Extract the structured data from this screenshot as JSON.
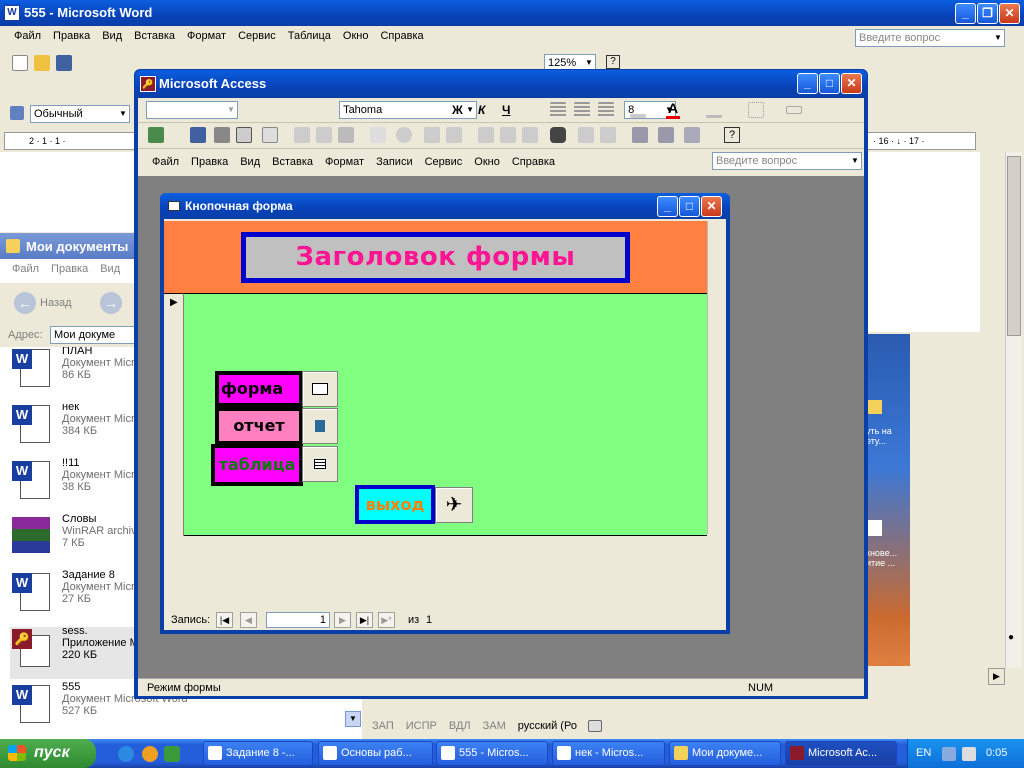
{
  "word": {
    "title": "555 - Microsoft Word",
    "menu": [
      "Файл",
      "Правка",
      "Вид",
      "Вставка",
      "Формат",
      "Сервис",
      "Таблица",
      "Окно",
      "Справка"
    ],
    "ask_placeholder": "Введите вопрос",
    "zoom": "125%",
    "style": "Обычный",
    "ruler_left": "2 · 1 · 1 ·",
    "ruler_right": "· 16 · ↓ · 17 ·",
    "status": [
      "ЗАП",
      "ИСПР",
      "ВДЛ",
      "ЗАМ",
      "русский (Ро"
    ]
  },
  "explorer": {
    "title": "Мои документы",
    "menu": [
      "Файл",
      "Правка",
      "Вид"
    ],
    "back": "Назад",
    "address_label": "Адрес:",
    "address_value": "Мои докуме",
    "files": [
      {
        "name": "ПЛАН",
        "type": "Документ Micr",
        "size": "86 КБ",
        "icon": "word-doc-icon"
      },
      {
        "name": "нек",
        "type": "Документ Micr",
        "size": "384 КБ",
        "icon": "word-doc-icon"
      },
      {
        "name": "!!11",
        "type": "Документ Micr",
        "size": "38 КБ",
        "icon": "word-doc-icon"
      },
      {
        "name": "Словы",
        "type": "WinRAR archiv",
        "size": "7 КБ",
        "icon": "winrar-icon"
      },
      {
        "name": "Задание 8",
        "type": "Документ Micr",
        "size": "27 КБ",
        "icon": "word-doc-icon"
      },
      {
        "name": "sess.",
        "type": "Приложение M",
        "size": "220 КБ",
        "icon": "access-db-icon"
      },
      {
        "name": "555",
        "type": "Документ Microsoft Word",
        "size": "527 КБ",
        "icon": "word-doc-icon"
      }
    ]
  },
  "desktop": {
    "labels": [
      "уть на",
      "ету...",
      "кнове...",
      "итие ..."
    ]
  },
  "access": {
    "title": "Microsoft Access",
    "font": "Tahoma",
    "font_size": "8",
    "bold": "Ж",
    "italic": "К",
    "underline": "Ч",
    "menu": [
      "Файл",
      "Правка",
      "Вид",
      "Вставка",
      "Формат",
      "Записи",
      "Сервис",
      "Окно",
      "Справка"
    ],
    "ask_placeholder": "Введите вопрос",
    "status_left": "Режим формы",
    "status_num": "NUM"
  },
  "form": {
    "title": "Кнопочная форма",
    "header": "Заголовок формы",
    "buttons": {
      "forma": "форма",
      "otchet": "отчет",
      "tablica": "таблица",
      "vyhod": "выход"
    },
    "nav": {
      "label": "Запись:",
      "current": "1",
      "of": "из",
      "total": "1"
    },
    "colors": {
      "header_bg": "#ff8040",
      "detail_bg": "#80ff80",
      "title_text": "#ff1493",
      "magenta": "#ff00ff",
      "pink": "#ff80c0",
      "cyan": "#00ffff"
    }
  },
  "taskbar": {
    "start": "пуск",
    "items": [
      "Задание 8 -...",
      "Основы раб...",
      "555 - Micros...",
      "нек - Micros...",
      "Мои докуме...",
      "Microsoft Ac..."
    ],
    "lang": "EN",
    "time": "0:05"
  }
}
